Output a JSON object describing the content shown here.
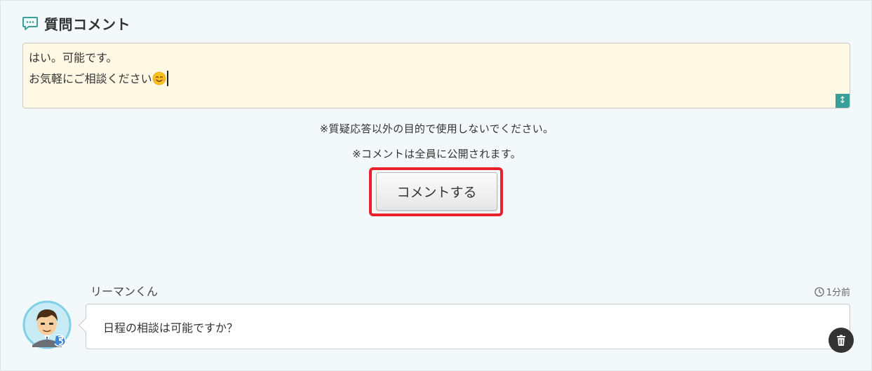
{
  "section": {
    "title": "質問コメント"
  },
  "composer": {
    "line1": "はい。可能です。",
    "line2": "お気軽にご相談ください",
    "resize_glyph": "↕"
  },
  "notices": {
    "purpose": "※質疑応答以外の目的で使用しないでください。",
    "public": "※コメントは全員に公開されます。"
  },
  "submit": {
    "label": "コメントする",
    "highlight_color": "#e8212b"
  },
  "comment": {
    "author": "リーマンくん",
    "time": "1分前",
    "text": "日程の相談は可能ですか？"
  },
  "colors": {
    "accent": "#3a9e99",
    "composer_bg": "#fff8e5",
    "panel_bg": "#f3f9fa"
  },
  "icons": {
    "section": "chat-bubble-icon",
    "emoji": "smiling-face-emoji",
    "time": "clock-icon",
    "delete": "trash-icon",
    "resize": "resize-vertical-icon"
  }
}
